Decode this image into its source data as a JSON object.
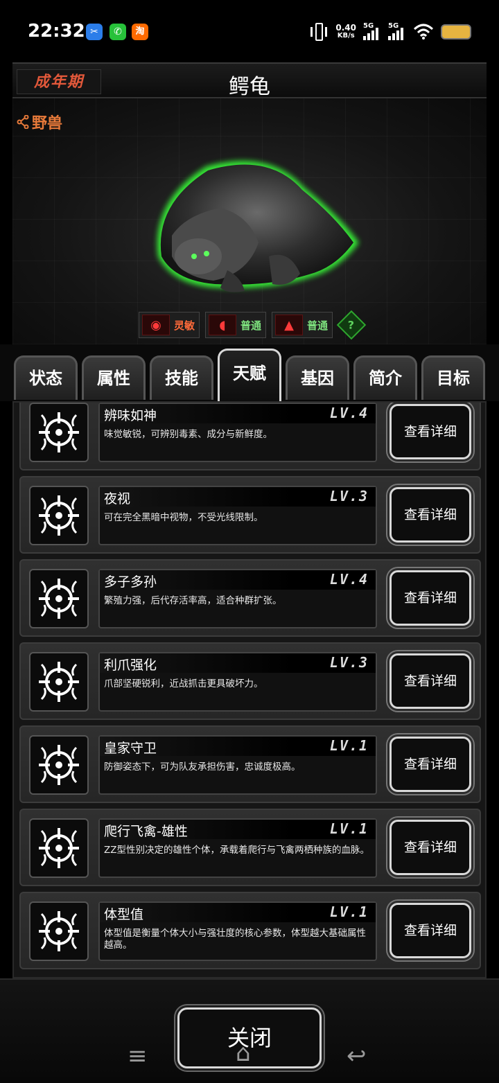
{
  "status_bar": {
    "time": "22:32",
    "apps": [
      {
        "icon": "app-blue-icon",
        "color": "#2b7de9",
        "glyph": "✂"
      },
      {
        "icon": "wechat-icon",
        "color": "#27c13a",
        "glyph": "✆"
      },
      {
        "icon": "taobao-icon",
        "color": "#ff6a00",
        "glyph": "淘"
      }
    ],
    "speed_value": "0.40",
    "speed_unit": "KB/s",
    "network1": "5G",
    "network2": "5G"
  },
  "header": {
    "stage": "成年期",
    "title": "鳄龟"
  },
  "creature": {
    "category": "野兽"
  },
  "traits": [
    {
      "icon": "eye-icon",
      "label": "灵敏",
      "color": "#ff6a3a"
    },
    {
      "icon": "ear-icon",
      "label": "普通",
      "color": "#7de07d"
    },
    {
      "icon": "nose-icon",
      "label": "普通",
      "color": "#7de07d"
    }
  ],
  "tabs": [
    {
      "label": "状态"
    },
    {
      "label": "属性"
    },
    {
      "label": "技能"
    },
    {
      "label": "天赋",
      "active": true
    },
    {
      "label": "基因"
    },
    {
      "label": "简介"
    },
    {
      "label": "目标"
    }
  ],
  "talents": [
    {
      "name": "辨味如神",
      "level": "LV.4",
      "desc": "味觉敏锐，可辨别毒素、成分与新鲜度。"
    },
    {
      "name": "夜视",
      "level": "LV.3",
      "desc": "可在完全黑暗中视物，不受光线限制。"
    },
    {
      "name": "多子多孙",
      "level": "LV.4",
      "desc": "繁殖力强，后代存活率高，适合种群扩张。"
    },
    {
      "name": "利爪强化",
      "level": "LV.3",
      "desc": "爪部坚硬锐利，近战抓击更具破坏力。"
    },
    {
      "name": "皇家守卫",
      "level": "LV.1",
      "desc": "防御姿态下，可为队友承担伤害，忠诚度极高。"
    },
    {
      "name": "爬行飞禽-雄性",
      "level": "LV.1",
      "desc": "ZZ型性别决定的雄性个体，承载着爬行与飞禽两栖种族的血脉。"
    },
    {
      "name": "体型值",
      "level": "LV.1",
      "desc": "体型值是衡量个体大小与强壮度的核心参数，体型越大基础属性越高。"
    }
  ],
  "detail_label": "查看详细",
  "close_label": "关闭"
}
